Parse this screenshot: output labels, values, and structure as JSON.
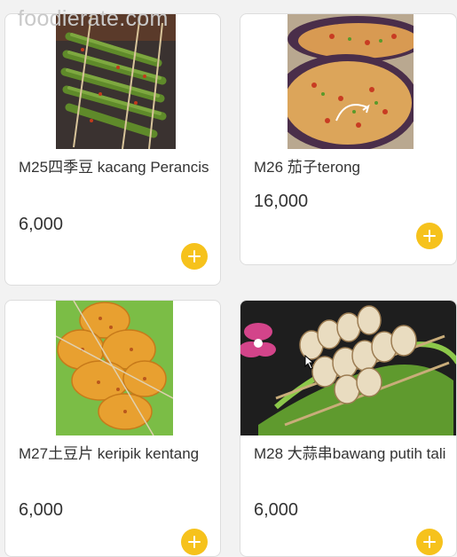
{
  "watermark": "foodierate.com",
  "products": [
    {
      "title": "M25四季豆 kacang Perancis",
      "price": "6,000",
      "image_desc": "grilled-green-beans-skewers",
      "add_icon": "plus-icon"
    },
    {
      "title": "M26 茄子terong",
      "price": "16,000",
      "image_desc": "grilled-eggplant",
      "add_icon": "plus-icon"
    },
    {
      "title": "M27土豆片 keripik kentang",
      "price": "6,000",
      "image_desc": "potato-slice-skewers",
      "add_icon": "plus-icon"
    },
    {
      "title": "M28 大蒜串bawang putih tali",
      "price": "6,000",
      "image_desc": "garlic-skewers",
      "add_icon": "plus-icon"
    }
  ],
  "colors": {
    "accent": "#f6c21c",
    "card_bg": "#ffffff",
    "page_bg": "#f2f2f2",
    "text": "#333333"
  }
}
